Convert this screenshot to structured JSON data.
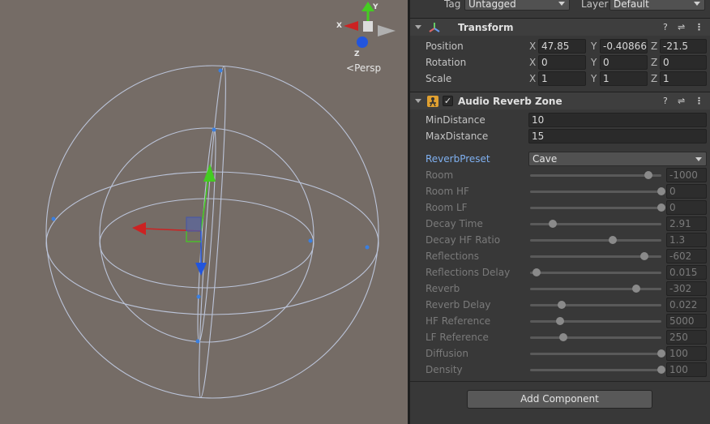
{
  "scene": {
    "persp_label": "Persp",
    "axis_labels": {
      "x": "X",
      "y": "Y",
      "z": "Z"
    },
    "colors": {
      "background": "#756c66",
      "wire": "#c8d4ee",
      "x_axis": "#cc2222",
      "y_axis": "#44cc22",
      "z_axis": "#2255dd"
    }
  },
  "header": {
    "tag_label": "Tag",
    "tag_value": "Untagged",
    "layer_label": "Layer",
    "layer_value": "Default"
  },
  "transform": {
    "title": "Transform",
    "position": {
      "label": "Position",
      "x": "47.85",
      "y": "-0.40866",
      "z": "-21.5"
    },
    "rotation": {
      "label": "Rotation",
      "x": "0",
      "y": "0",
      "z": "0"
    },
    "scale": {
      "label": "Scale",
      "x": "1",
      "y": "1",
      "z": "1"
    }
  },
  "reverb_zone": {
    "title": "Audio Reverb Zone",
    "enabled_glyph": "✓",
    "min_distance": {
      "label": "MinDistance",
      "value": "10"
    },
    "max_distance": {
      "label": "MaxDistance",
      "value": "15"
    },
    "preset": {
      "label": "ReverbPreset",
      "value": "Cave"
    },
    "params": [
      {
        "label": "Room",
        "value": "-1000",
        "level": 0.9
      },
      {
        "label": "Room HF",
        "value": "0",
        "level": 1.0
      },
      {
        "label": "Room LF",
        "value": "0",
        "level": 1.0
      },
      {
        "label": "Decay Time",
        "value": "2.91",
        "level": 0.17
      },
      {
        "label": "Decay HF Ratio",
        "value": "1.3",
        "level": 0.63
      },
      {
        "label": "Reflections",
        "value": "-602",
        "level": 0.87
      },
      {
        "label": "Reflections Delay",
        "value": "0.015",
        "level": 0.05
      },
      {
        "label": "Reverb",
        "value": "-302",
        "level": 0.81
      },
      {
        "label": "Reverb Delay",
        "value": "0.022",
        "level": 0.24
      },
      {
        "label": "HF Reference",
        "value": "5000",
        "level": 0.23
      },
      {
        "label": "LF Reference",
        "value": "250",
        "level": 0.25
      },
      {
        "label": "Diffusion",
        "value": "100",
        "level": 1.0
      },
      {
        "label": "Density",
        "value": "100",
        "level": 1.0
      }
    ]
  },
  "add_component_label": "Add Component"
}
